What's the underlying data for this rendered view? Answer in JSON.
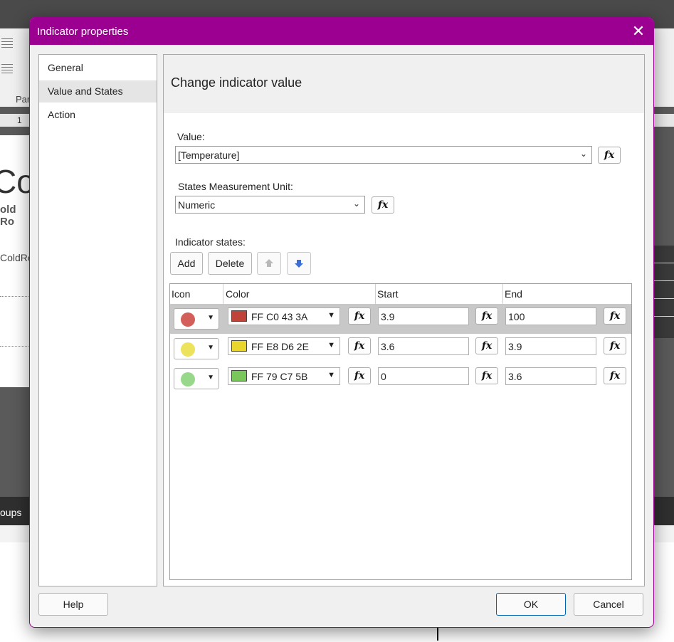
{
  "background": {
    "ribbon_label": "Par",
    "ruler_mark": "1",
    "doc_big_text": "Col",
    "doc_bold_text": "old Ro",
    "doc_field_text": "ColdRo",
    "groups_label": "oups"
  },
  "dialog": {
    "title": "Indicator properties",
    "close_glyph": "✕",
    "nav": [
      {
        "label": "General",
        "selected": false
      },
      {
        "label": "Value and States",
        "selected": true
      },
      {
        "label": "Action",
        "selected": false
      }
    ],
    "panel_title": "Change indicator value",
    "value_label": "Value:",
    "value": "[Temperature]",
    "unit_label": "States Measurement Unit:",
    "unit": "Numeric",
    "states_label": "Indicator states:",
    "fx_label": "fx",
    "add_label": "Add",
    "delete_label": "Delete",
    "columns": {
      "icon": "Icon",
      "color": "Color",
      "start": "Start",
      "end": "End"
    },
    "rows": [
      {
        "icon_color": "#d35f5a",
        "swatch": "#C0433A",
        "color": "FF C0 43 3A",
        "start": "3.9",
        "end": "100"
      },
      {
        "icon_color": "#ece25c",
        "swatch": "#E8D62E",
        "color": "FF E8 D6 2E",
        "start": "3.6",
        "end": "3.9"
      },
      {
        "icon_color": "#98d88a",
        "swatch": "#79C75B",
        "color": "FF 79 C7 5B",
        "start": "0",
        "end": "3.6"
      }
    ],
    "help_label": "Help",
    "ok_label": "OK",
    "cancel_label": "Cancel"
  },
  "colors": {
    "title_bar": "#9c0090",
    "row_selected": "#c8c8c8"
  },
  "icons": [
    "close-icon",
    "chevron-down-icon",
    "arrow-up-icon",
    "arrow-down-icon",
    "fx-icon"
  ]
}
